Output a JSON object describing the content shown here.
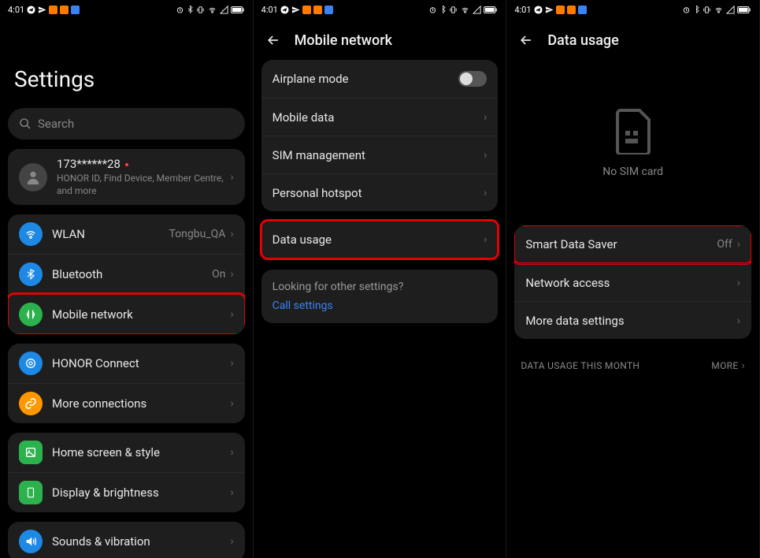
{
  "status": {
    "time": "4:01",
    "square_colors": [
      "#ff7a00",
      "#ff7a00",
      "#3b82f6"
    ]
  },
  "panel1": {
    "title": "Settings",
    "search_placeholder": "Search",
    "account": {
      "id": "173******28",
      "sub": "HONOR ID, Find Device, Member Centre, and more"
    },
    "group1": [
      {
        "label": "WLAN",
        "value": "Tongbu_QA",
        "icon": "wifi",
        "color": "#1e88e5"
      },
      {
        "label": "Bluetooth",
        "value": "On",
        "icon": "bluetooth",
        "color": "#1e88e5"
      },
      {
        "label": "Mobile network",
        "icon": "network",
        "color": "#2bb24c",
        "highlight": true
      }
    ],
    "group2": [
      {
        "label": "HONOR Connect",
        "icon": "connect",
        "color": "#1e88e5"
      },
      {
        "label": "More connections",
        "icon": "link",
        "color": "#ff9800"
      }
    ],
    "group3": [
      {
        "label": "Home screen & style",
        "icon": "home",
        "color": "#2bb24c"
      },
      {
        "label": "Display & brightness",
        "icon": "display",
        "color": "#2bb24c"
      }
    ],
    "group4": [
      {
        "label": "Sounds & vibration",
        "icon": "sound",
        "color": "#1e88e5"
      }
    ]
  },
  "panel2": {
    "title": "Mobile network",
    "group1": [
      {
        "label": "Airplane mode",
        "type": "toggle"
      },
      {
        "label": "Mobile data"
      },
      {
        "label": "SIM management"
      },
      {
        "label": "Personal hotspot"
      }
    ],
    "group2": [
      {
        "label": "Data usage",
        "highlight": true
      }
    ],
    "hint": "Looking for other settings?",
    "hint_link": "Call settings"
  },
  "panel3": {
    "title": "Data usage",
    "no_sim": "No SIM card",
    "group1": [
      {
        "label": "Smart Data Saver",
        "value": "Off",
        "highlight": true
      },
      {
        "label": "Network access"
      },
      {
        "label": "More data settings"
      }
    ],
    "section_header": "DATA USAGE THIS MONTH",
    "section_more": "MORE"
  }
}
